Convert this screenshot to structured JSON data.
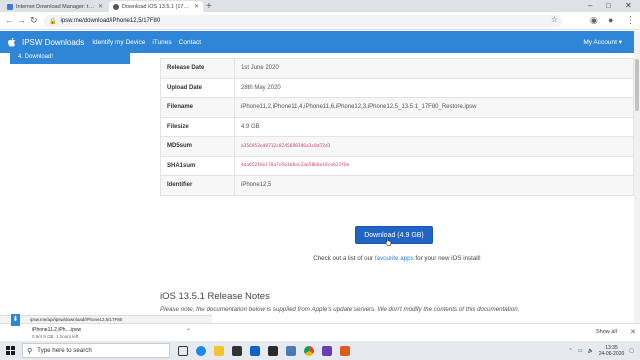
{
  "browser": {
    "tabs": [
      {
        "title": "Internet Download Manager: the ..."
      },
      {
        "title": "Download iOS 13.5.1 (17F80) for ..."
      }
    ],
    "url": "ipsw.me/download/iPhone12,5/17F80"
  },
  "site": {
    "brand": "IPSW Downloads",
    "nav": [
      "Identify my Device",
      "iTunes",
      "Contact"
    ],
    "account": "My Account",
    "step_active": "4. Download!"
  },
  "info_rows": [
    {
      "key": "Release Date",
      "value": "1st June 2020"
    },
    {
      "key": "Upload Date",
      "value": "28th May 2020"
    },
    {
      "key": "Filename",
      "value": "iPhone11,2,iPhone11,4,iPhone11,6,iPhone12,3,iPhone12,5_13.5.1_17F80_Restore.ipsw"
    },
    {
      "key": "Filesize",
      "value": "4.9 GB"
    },
    {
      "key": "MD5sum",
      "value": "a356953ed8712c8245698396a3c8d72d3"
    },
    {
      "key": "SHA1sum",
      "value": "4da65216e178a7e561b8ac2a658b8e18ce621f6e"
    },
    {
      "key": "Identifier",
      "value": "iPhone12,5"
    }
  ],
  "download_button": "Download (4.9 GB)",
  "checkout": {
    "before": "Check out a list of our ",
    "link": "favourite apps",
    "after": " for your new iOS install!"
  },
  "notes": {
    "title": "iOS 13.5.1 Release Notes",
    "desc": "Please note, the documentation below is supplied from Apple's update servers. We don't modify the contents of this documentation."
  },
  "status_url": "ipsw.me/api/ipsw/download/iPhone12,5/17F80",
  "download_shelf": {
    "filename": "iPhone11,2,iPh....ipsw",
    "progress": "0.9/4.9 GB, 1 hours left",
    "show_all": "Show all"
  },
  "taskbar": {
    "search_placeholder": "Type here to search",
    "time": "13:35",
    "date": "24-06-2020"
  },
  "colors": {
    "brand_blue": "#2f86d6",
    "button_blue": "#2064c4",
    "hash_red": "#d1435b"
  }
}
